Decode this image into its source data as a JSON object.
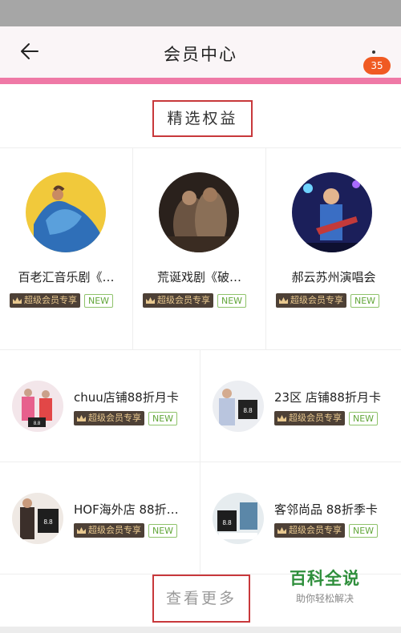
{
  "nav": {
    "title": "会员中心",
    "badge": "35",
    "back_icon": "arrow-left-icon",
    "more_icon": "more-vertical-icon"
  },
  "section": {
    "title": "精选权益"
  },
  "benefits_top": [
    {
      "name": "百老汇音乐剧《…",
      "vip_label": "超级会员专享",
      "new_label": "NEW"
    },
    {
      "name": "荒诞戏剧《破…",
      "vip_label": "超级会员专享",
      "new_label": "NEW"
    },
    {
      "name": "郝云苏州演唱会",
      "vip_label": "超级会员专享",
      "new_label": "NEW"
    }
  ],
  "benefits_list": [
    {
      "name": "chuu店铺88折月卡",
      "vip_label": "超级会员专享",
      "new_label": "NEW"
    },
    {
      "name": "23区 店铺88折月卡",
      "vip_label": "超级会员专享",
      "new_label": "NEW"
    },
    {
      "name": "HOF海外店 88折…",
      "vip_label": "超级会员专享",
      "new_label": "NEW"
    },
    {
      "name": "客邻尚品 88折季卡",
      "vip_label": "超级会员专享",
      "new_label": "NEW"
    }
  ],
  "view_more": "查看更多",
  "watermark": {
    "title": "百科全说",
    "subtitle": "助你轻松解决"
  },
  "colors": {
    "pink_strip": "#ef79a6",
    "badge": "#f05a22",
    "highlight_box": "#c8383b",
    "vip_bg": "#4d4036",
    "vip_text": "#e8c88f",
    "new_text": "#62a63a",
    "watermark_green": "#2f8f3c"
  }
}
